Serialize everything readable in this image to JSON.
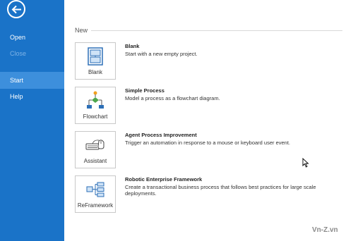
{
  "sidebar": {
    "items": [
      {
        "label": "Open"
      },
      {
        "label": "Close"
      },
      {
        "label": "Start"
      },
      {
        "label": "Help"
      }
    ],
    "color": "#1a73c8",
    "active_color": "#3d8fdc"
  },
  "main": {
    "section_title": "New",
    "templates": [
      {
        "tile_label": "Blank",
        "title": "Blank",
        "description": "Start with a new empty project.",
        "icon": "blank-project-icon"
      },
      {
        "tile_label": "Flowchart",
        "title": "Simple Process",
        "description": "Model a process as a flowchart diagram.",
        "icon": "flowchart-icon"
      },
      {
        "tile_label": "Assistant",
        "title": "Agent Process Improvement",
        "description": "Trigger an automation in response to a mouse or keyboard user event.",
        "icon": "mouse-keyboard-icon"
      },
      {
        "tile_label": "ReFramework",
        "title": "Robotic Enterprise Framework",
        "description": "Create a transactional business process that follows best practices for large scale deployments.",
        "icon": "framework-icon"
      }
    ]
  },
  "watermark": "Vn-Z.vn"
}
